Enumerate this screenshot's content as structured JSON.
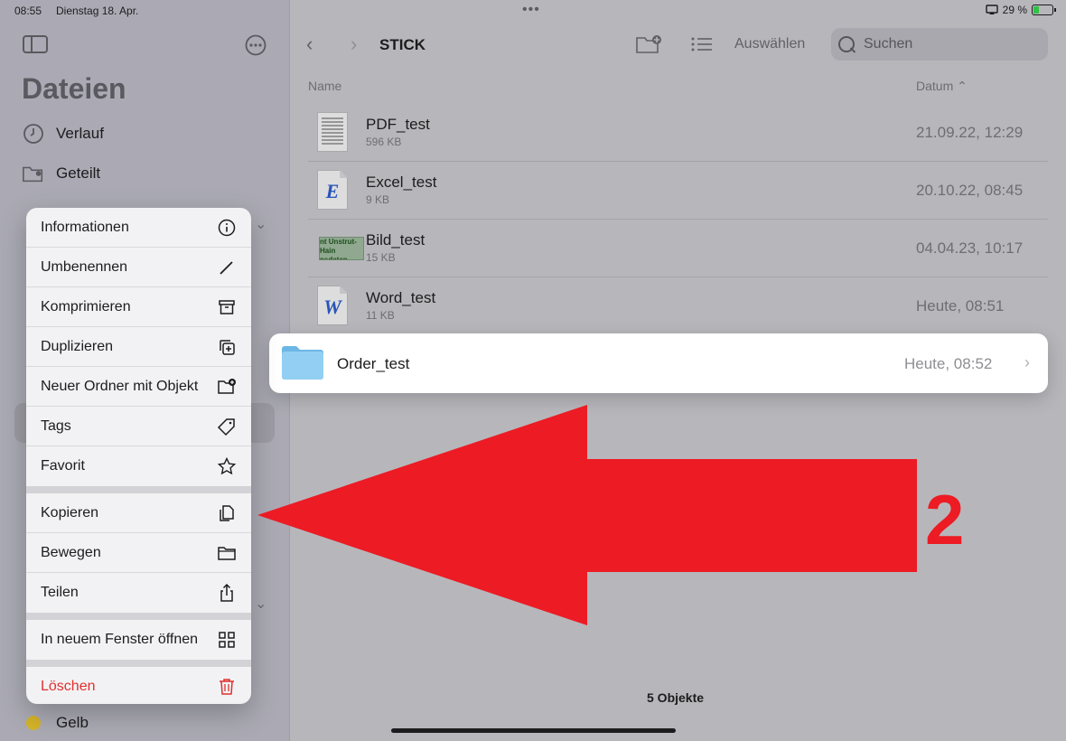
{
  "status": {
    "time": "08:55",
    "date": "Dienstag 18. Apr.",
    "battery": "29 %"
  },
  "sidebar": {
    "title": "Dateien",
    "items": [
      {
        "label": "Verlauf",
        "icon": "clock-icon"
      },
      {
        "label": "Geteilt",
        "icon": "shared-folder-icon"
      }
    ],
    "tag_item": {
      "label": "Gelb",
      "color": "#d4b42a"
    }
  },
  "main": {
    "folder_title": "STICK",
    "select_label": "Auswählen",
    "search_placeholder": "Suchen",
    "col_name": "Name",
    "col_date": "Datum",
    "files": [
      {
        "name": "PDF_test",
        "size": "596 KB",
        "date": "21.09.22, 12:29",
        "type": "pdf"
      },
      {
        "name": "Excel_test",
        "size": "9 KB",
        "date": "20.10.22, 08:45",
        "type": "excel"
      },
      {
        "name": "Bild_test",
        "size": "15 KB",
        "date": "04.04.23, 10:17",
        "type": "image",
        "thumb_text": "nt Unstrut-Hain nsdaten"
      },
      {
        "name": "Word_test",
        "size": "11 KB",
        "date": "Heute, 08:51",
        "type": "word"
      }
    ],
    "highlighted": {
      "name": "Order_test",
      "date": "Heute, 08:52"
    },
    "total": "5 Objekte"
  },
  "menu": {
    "items": [
      {
        "label": "Informationen",
        "icon": "info-icon"
      },
      {
        "label": "Umbenennen",
        "icon": "pencil-icon"
      },
      {
        "label": "Komprimieren",
        "icon": "archive-icon"
      },
      {
        "label": "Duplizieren",
        "icon": "duplicate-icon"
      },
      {
        "label": "Neuer Ordner mit Objekt",
        "icon": "new-folder-icon"
      },
      {
        "label": "Tags",
        "icon": "tag-icon"
      },
      {
        "label": "Favorit",
        "icon": "star-icon"
      },
      {
        "label": "Kopieren",
        "icon": "copy-icon"
      },
      {
        "label": "Bewegen",
        "icon": "folder-icon"
      },
      {
        "label": "Teilen",
        "icon": "share-icon"
      },
      {
        "label": "In neuem Fenster öffnen",
        "icon": "grid-icon"
      },
      {
        "label": "Löschen",
        "icon": "trash-icon"
      }
    ]
  },
  "annotation": {
    "number": "2",
    "color": "#ec1b24"
  }
}
